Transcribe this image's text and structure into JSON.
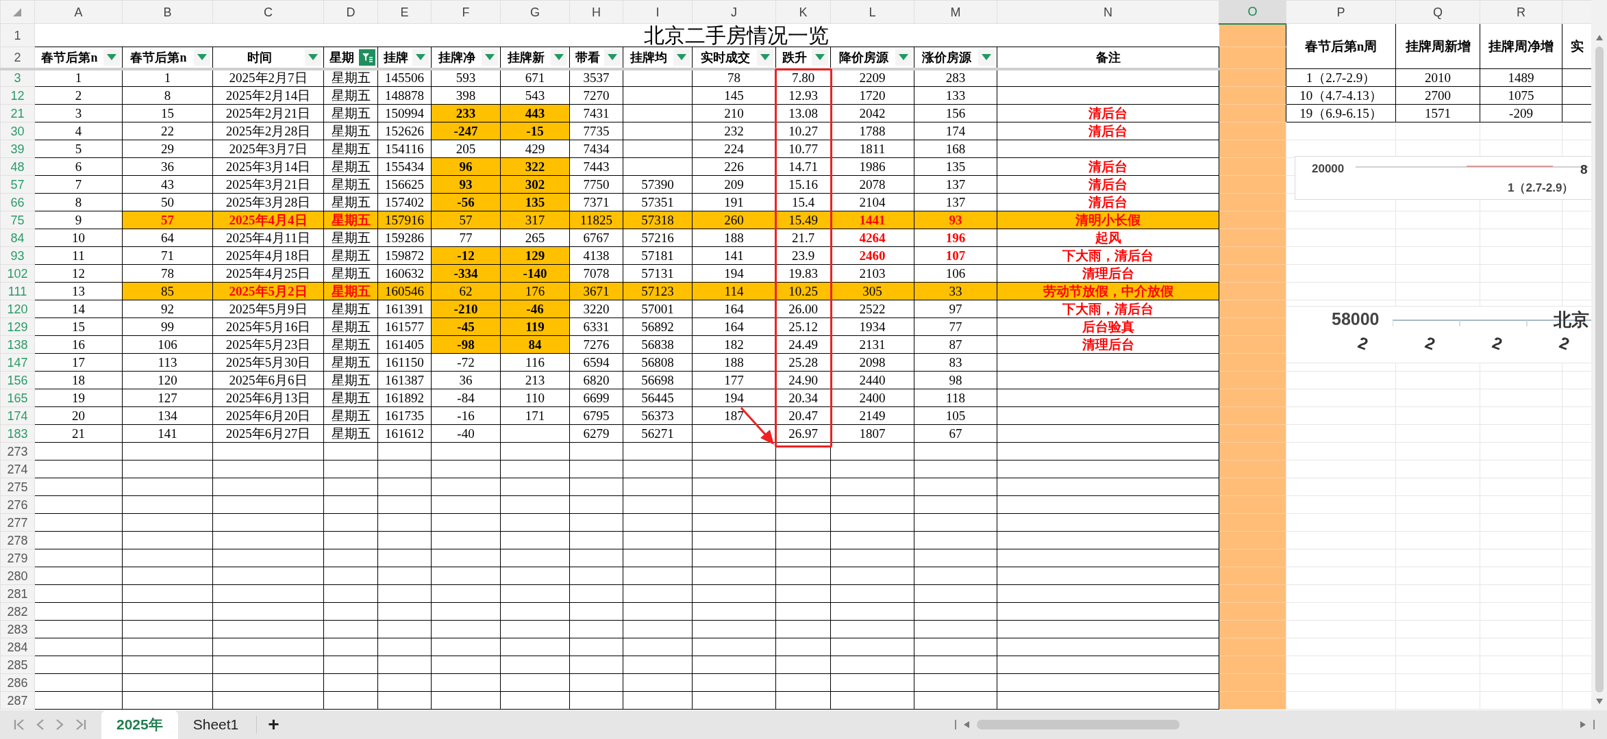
{
  "column_headers": [
    {
      "letter": "A",
      "selected": false
    },
    {
      "letter": "B",
      "selected": false
    },
    {
      "letter": "C",
      "selected": false
    },
    {
      "letter": "D",
      "selected": false
    },
    {
      "letter": "E",
      "selected": false
    },
    {
      "letter": "F",
      "selected": false
    },
    {
      "letter": "G",
      "selected": false
    },
    {
      "letter": "H",
      "selected": false
    },
    {
      "letter": "I",
      "selected": false
    },
    {
      "letter": "J",
      "selected": false
    },
    {
      "letter": "K",
      "selected": false
    },
    {
      "letter": "L",
      "selected": false
    },
    {
      "letter": "M",
      "selected": false
    },
    {
      "letter": "N",
      "selected": false
    },
    {
      "letter": "O",
      "selected": true
    },
    {
      "letter": "P",
      "selected": false
    },
    {
      "letter": "Q",
      "selected": false
    },
    {
      "letter": "R",
      "selected": false
    }
  ],
  "title": {
    "row_number": "1",
    "text": "北京二手房情况一览"
  },
  "header_row": {
    "row_number": "2",
    "columns": [
      {
        "label": "春节后第n",
        "filter_active": false
      },
      {
        "label": "春节后第n",
        "filter_active": false
      },
      {
        "label": "时间",
        "filter_active": false
      },
      {
        "label": "星期",
        "filter_active": true
      },
      {
        "label": "挂牌",
        "filter_active": false
      },
      {
        "label": "挂牌净",
        "filter_active": false
      },
      {
        "label": "挂牌新",
        "filter_active": false
      },
      {
        "label": "带看",
        "filter_active": false
      },
      {
        "label": "挂牌均",
        "filter_active": false
      },
      {
        "label": "实时成交",
        "filter_active": false
      },
      {
        "label": "跌升",
        "filter_active": false
      },
      {
        "label": "降价房源",
        "filter_active": false
      },
      {
        "label": "涨价房源",
        "filter_active": false
      },
      {
        "label": "备注"
      }
    ]
  },
  "rows": [
    {
      "number": "3",
      "cells": [
        "1",
        "1",
        "2025年2月7日",
        "星期五",
        "145506",
        "593",
        "671",
        "3537",
        null,
        "78",
        "7.80",
        "2209",
        "283",
        null
      ],
      "highlighted": false,
      "flagged": false,
      "red_week": false,
      "red_date": false,
      "red_price": false
    },
    {
      "number": "12",
      "cells": [
        "2",
        "8",
        "2025年2月14日",
        "星期五",
        "148878",
        "398",
        "543",
        "7270",
        null,
        "145",
        "12.93",
        "1720",
        "133",
        null
      ],
      "highlighted": false,
      "flagged": false,
      "red_week": false,
      "red_date": false,
      "red_price": false
    },
    {
      "number": "21",
      "cells": [
        "3",
        "15",
        "2025年2月21日",
        "星期五",
        "150994",
        "233",
        "443",
        "7431",
        null,
        "210",
        "13.08",
        "2042",
        "156",
        "清后台"
      ],
      "highlighted": false,
      "flagged": true,
      "red_week": false,
      "red_date": false,
      "red_price": false
    },
    {
      "number": "30",
      "cells": [
        "4",
        "22",
        "2025年2月28日",
        "星期五",
        "152626",
        "-247",
        "-15",
        "7735",
        null,
        "232",
        "10.27",
        "1788",
        "174",
        "清后台"
      ],
      "highlighted": false,
      "flagged": true,
      "red_week": false,
      "red_date": false,
      "red_price": false
    },
    {
      "number": "39",
      "cells": [
        "5",
        "29",
        "2025年3月7日",
        "星期五",
        "154116",
        "205",
        "429",
        "7434",
        null,
        "224",
        "10.77",
        "1811",
        "168",
        null
      ],
      "highlighted": false,
      "flagged": false,
      "red_week": false,
      "red_date": false,
      "red_price": false
    },
    {
      "number": "48",
      "cells": [
        "6",
        "36",
        "2025年3月14日",
        "星期五",
        "155434",
        "96",
        "322",
        "7443",
        null,
        "226",
        "14.71",
        "1986",
        "135",
        "清后台"
      ],
      "highlighted": false,
      "flagged": true,
      "red_week": false,
      "red_date": false,
      "red_price": false
    },
    {
      "number": "57",
      "cells": [
        "7",
        "43",
        "2025年3月21日",
        "星期五",
        "156625",
        "93",
        "302",
        "7750",
        "57390",
        "209",
        "15.16",
        "2078",
        "137",
        "清后台"
      ],
      "highlighted": false,
      "flagged": true,
      "red_week": false,
      "red_date": false,
      "red_price": false
    },
    {
      "number": "66",
      "cells": [
        "8",
        "50",
        "2025年3月28日",
        "星期五",
        "157402",
        "-56",
        "135",
        "7371",
        "57351",
        "191",
        "15.4",
        "2104",
        "137",
        "清后台"
      ],
      "highlighted": false,
      "flagged": true,
      "red_week": false,
      "red_date": false,
      "red_price": false
    },
    {
      "number": "75",
      "cells": [
        "9",
        "57",
        "2025年4月4日",
        "星期五",
        "157916",
        "57",
        "317",
        "11825",
        "57318",
        "260",
        "15.49",
        "1441",
        "93",
        "清明小长假"
      ],
      "highlighted": true,
      "flagged": false,
      "red_week": true,
      "red_date": true,
      "red_price": true
    },
    {
      "number": "84",
      "cells": [
        "10",
        "64",
        "2025年4月11日",
        "星期五",
        "159286",
        "77",
        "265",
        "6767",
        "57216",
        "188",
        "21.7",
        "4264",
        "196",
        "起风"
      ],
      "highlighted": false,
      "flagged": false,
      "red_week": false,
      "red_date": false,
      "red_price": true
    },
    {
      "number": "93",
      "cells": [
        "11",
        "71",
        "2025年4月18日",
        "星期五",
        "159872",
        "-12",
        "129",
        "4138",
        "57181",
        "141",
        "23.9",
        "2460",
        "107",
        "下大雨，清后台"
      ],
      "highlighted": false,
      "flagged": true,
      "red_week": false,
      "red_date": false,
      "red_price": true
    },
    {
      "number": "102",
      "cells": [
        "12",
        "78",
        "2025年4月25日",
        "星期五",
        "160632",
        "-334",
        "-140",
        "7078",
        "57131",
        "194",
        "19.83",
        "2103",
        "106",
        "清理后台"
      ],
      "highlighted": false,
      "flagged": true,
      "red_week": false,
      "red_date": false,
      "red_price": false
    },
    {
      "number": "111",
      "cells": [
        "13",
        "85",
        "2025年5月2日",
        "星期五",
        "160546",
        "62",
        "176",
        "3671",
        "57123",
        "114",
        "10.25",
        "305",
        "33",
        "劳动节放假，中介放假"
      ],
      "highlighted": true,
      "flagged": false,
      "red_week": false,
      "red_date": true,
      "red_price": false
    },
    {
      "number": "120",
      "cells": [
        "14",
        "92",
        "2025年5月9日",
        "星期五",
        "161391",
        "-210",
        "-46",
        "3220",
        "57001",
        "164",
        "26.00",
        "2522",
        "97",
        "下大雨，清后台"
      ],
      "highlighted": false,
      "flagged": true,
      "red_week": false,
      "red_date": false,
      "red_price": false
    },
    {
      "number": "129",
      "cells": [
        "15",
        "99",
        "2025年5月16日",
        "星期五",
        "161577",
        "-45",
        "119",
        "6331",
        "56892",
        "164",
        "25.12",
        "1934",
        "77",
        "后台验真"
      ],
      "highlighted": false,
      "flagged": true,
      "red_week": false,
      "red_date": false,
      "red_price": false
    },
    {
      "number": "138",
      "cells": [
        "16",
        "106",
        "2025年5月23日",
        "星期五",
        "161405",
        "-98",
        "84",
        "7276",
        "56838",
        "182",
        "24.49",
        "2131",
        "87",
        "清理后台"
      ],
      "highlighted": false,
      "flagged": true,
      "red_week": false,
      "red_date": false,
      "red_price": false
    },
    {
      "number": "147",
      "cells": [
        "17",
        "113",
        "2025年5月30日",
        "星期五",
        "161150",
        "-72",
        "116",
        "6594",
        "56808",
        "188",
        "25.28",
        "2098",
        "83",
        null
      ],
      "highlighted": false,
      "flagged": false,
      "red_week": false,
      "red_date": false,
      "red_price": false
    },
    {
      "number": "156",
      "cells": [
        "18",
        "120",
        "2025年6月6日",
        "星期五",
        "161387",
        "36",
        "213",
        "6820",
        "56698",
        "177",
        "24.90",
        "2440",
        "98",
        null
      ],
      "highlighted": false,
      "flagged": false,
      "red_week": false,
      "red_date": false,
      "red_price": false
    },
    {
      "number": "165",
      "cells": [
        "19",
        "127",
        "2025年6月13日",
        "星期五",
        "161892",
        "-84",
        "110",
        "6699",
        "56445",
        "194",
        "20.34",
        "2400",
        "118",
        null
      ],
      "highlighted": false,
      "flagged": false,
      "red_week": false,
      "red_date": false,
      "red_price": false
    },
    {
      "number": "174",
      "cells": [
        "20",
        "134",
        "2025年6月20日",
        "星期五",
        "161735",
        "-16",
        "171",
        "6795",
        "56373",
        "187",
        "20.47",
        "2149",
        "105",
        null
      ],
      "highlighted": false,
      "flagged": false,
      "red_week": false,
      "red_date": false,
      "red_price": false
    },
    {
      "number": "183",
      "cells": [
        "21",
        "141",
        "2025年6月27日",
        "星期五",
        "161612",
        "-40",
        null,
        "6279",
        "56271",
        null,
        "26.97",
        "1807",
        "67",
        null
      ],
      "highlighted": false,
      "flagged": false,
      "red_week": false,
      "red_date": false,
      "red_price": false
    }
  ],
  "empty_rows": [
    "273",
    "274",
    "275",
    "276",
    "277",
    "278",
    "279",
    "280",
    "281",
    "282",
    "283",
    "284",
    "285",
    "286",
    "287"
  ],
  "side_table": {
    "headers": [
      "春节后第n周",
      "挂牌周新增",
      "挂牌周净增",
      "实"
    ],
    "rows": [
      [
        "1（2.7-2.9）",
        "2010",
        "1489"
      ],
      [
        "10（4.7-4.13）",
        "2700",
        "1075"
      ],
      [
        "19（6.9-6.15）",
        "1571",
        "-209"
      ]
    ]
  },
  "charts": [
    {
      "kind": "line_fragment",
      "axis_label": "20000",
      "edge_label": "8",
      "category_label": "1（2.7-2.9）"
    },
    {
      "kind": "axis_fragment",
      "axis_label": "58000",
      "title": "北京",
      "tick_labels": [
        "2",
        "2",
        "2",
        "2"
      ]
    }
  ],
  "sheet_tabs": [
    {
      "label": "2025年",
      "selected": true
    },
    {
      "label": "Sheet1",
      "selected": false
    }
  ],
  "add_sheet": "+"
}
